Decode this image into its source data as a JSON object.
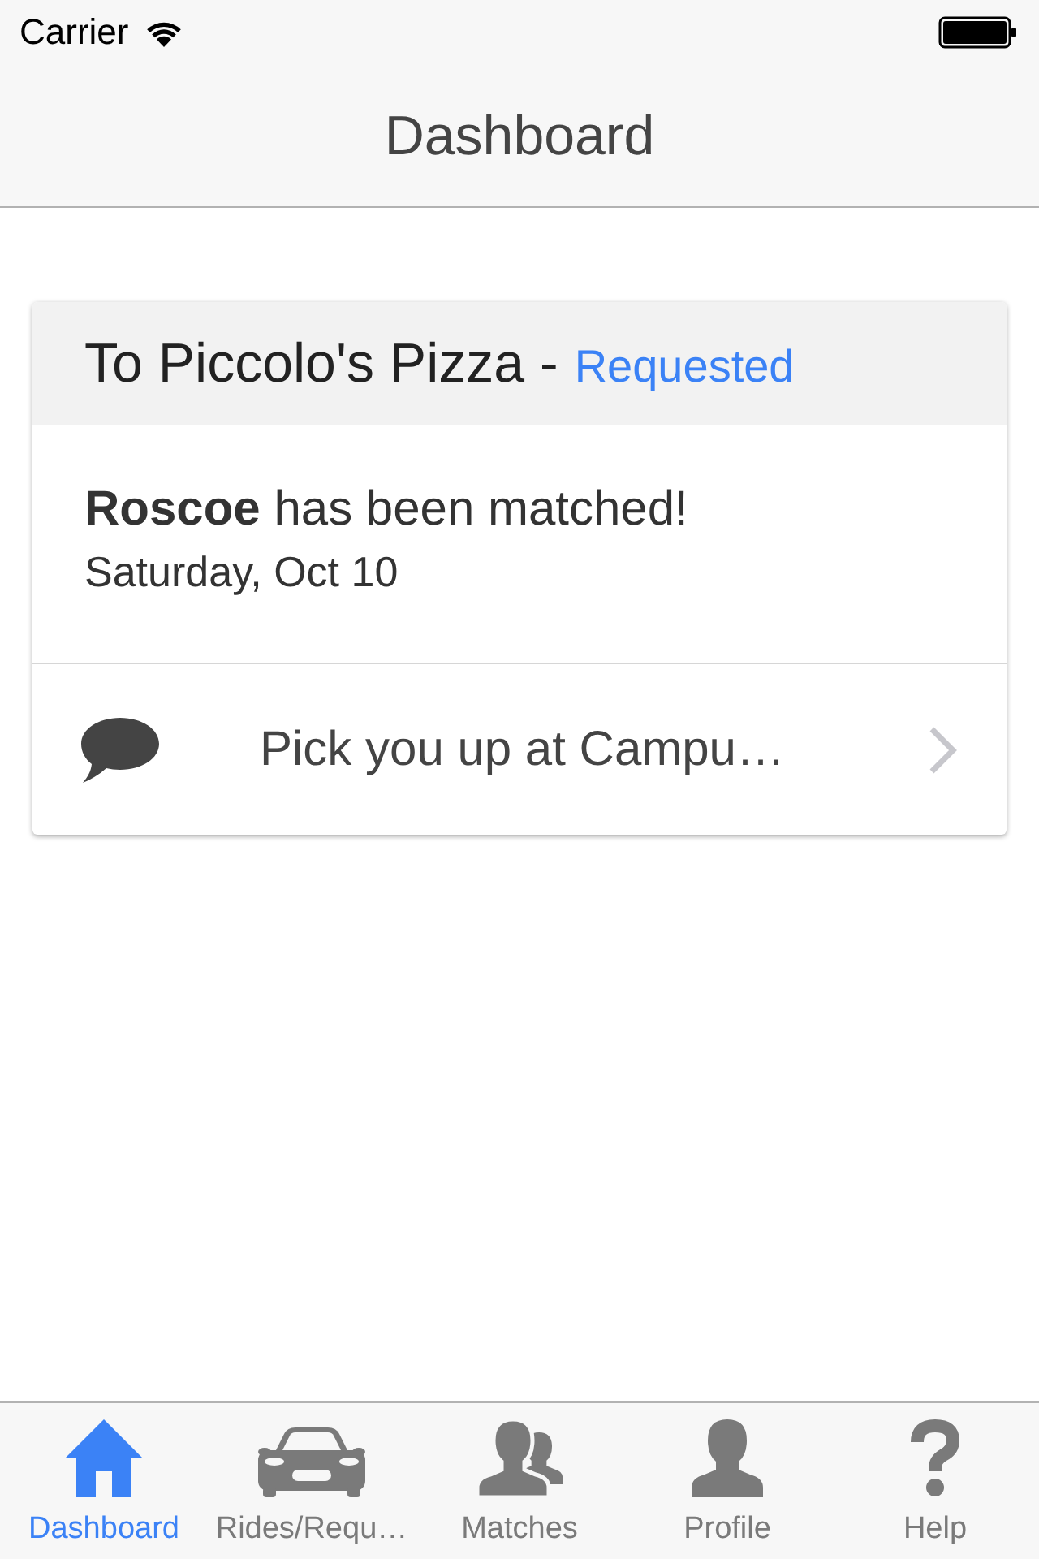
{
  "status_bar": {
    "carrier": "Carrier"
  },
  "nav_bar": {
    "title": "Dashboard"
  },
  "card": {
    "destination": "To Piccolo's Pizza -",
    "status": "Requested",
    "match_text": "**Roscoe** has been matched!",
    "date": "Saturday, Oct 10",
    "message": {
      "text": "Pick you up at Campu…"
    }
  },
  "tab_bar": {
    "tabs": [
      {
        "label": "Dashboard",
        "kind": "home",
        "selected": true
      },
      {
        "label": "Rides/Requ…",
        "kind": "car",
        "selected": false
      },
      {
        "label": "Matches",
        "kind": "group",
        "selected": false
      },
      {
        "label": "Profile",
        "kind": "person",
        "selected": false
      },
      {
        "label": "Help",
        "kind": "help",
        "selected": false
      }
    ]
  }
}
